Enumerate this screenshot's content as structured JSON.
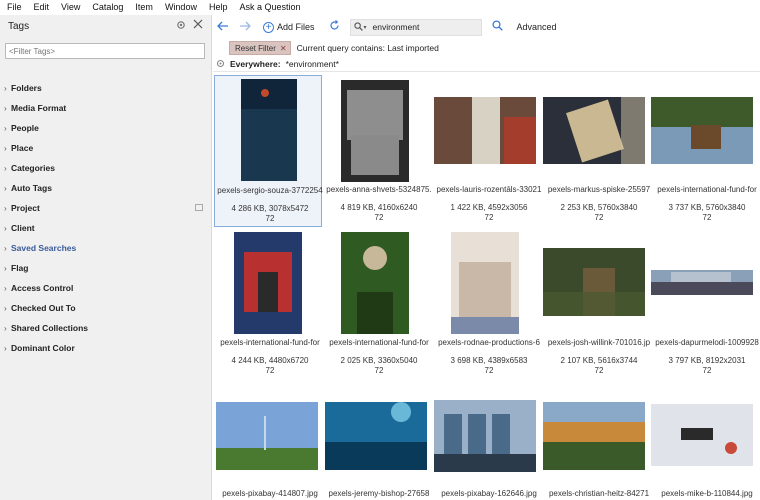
{
  "menu": [
    "File",
    "Edit",
    "View",
    "Catalog",
    "Item",
    "Window",
    "Help",
    "Ask a Question"
  ],
  "sidebar": {
    "title": "Tags",
    "filter_placeholder": "<Filter Tags>",
    "items": [
      {
        "label": "Folders"
      },
      {
        "label": "Media Format"
      },
      {
        "label": "People"
      },
      {
        "label": "Place"
      },
      {
        "label": "Categories"
      },
      {
        "label": "Auto Tags"
      },
      {
        "label": "Project"
      },
      {
        "label": "Client"
      },
      {
        "label": "Saved Searches"
      },
      {
        "label": "Flag"
      },
      {
        "label": "Access Control"
      },
      {
        "label": "Checked Out To"
      },
      {
        "label": "Shared Collections"
      },
      {
        "label": "Dominant Color"
      }
    ]
  },
  "toolbar": {
    "add_files": "Add Files",
    "search_value": "environment",
    "advanced": "Advanced"
  },
  "filter": {
    "reset_label": "Reset Filter",
    "query_text": "Current query contains: Last imported",
    "scope_label": "Everywhere:",
    "scope_value": "*environment*"
  },
  "assets": [
    {
      "name": "pexels-sergio-souza-3772254",
      "size": "4 286 KB, 3078x5472",
      "dpi": "72",
      "colors": [
        "#10253a",
        "#1f3f5a",
        "#c24a2a"
      ]
    },
    {
      "name": "pexels-anna-shvets-5324875.",
      "size": "4 819 KB, 4160x6240",
      "dpi": "72",
      "colors": [
        "#2a2a2a",
        "#8a8a8a",
        "#e0e0e0"
      ]
    },
    {
      "name": "pexels-lauris-rozentāls-33021",
      "size": "1 422 KB, 4592x3056",
      "dpi": "72",
      "colors": [
        "#6a4a3a",
        "#d8d2c4",
        "#b43a2a"
      ]
    },
    {
      "name": "pexels-markus-spiske-25597",
      "size": "2 253 KB, 5760x3840",
      "dpi": "72",
      "colors": [
        "#2a2f3a",
        "#c9b892",
        "#d2c6a4"
      ]
    },
    {
      "name": "pexels-international-fund-for",
      "size": "3 737 KB, 5760x3840",
      "dpi": "72",
      "colors": [
        "#3f5a2a",
        "#7a9ab8",
        "#6a4a2a"
      ]
    },
    {
      "name": "pexels-international-fund-for",
      "size": "4 244 KB, 4480x6720",
      "dpi": "72",
      "colors": [
        "#b83030",
        "#233a6a",
        "#2a2a2a"
      ]
    },
    {
      "name": "pexels-international-fund-for",
      "size": "2 025 KB, 3360x5040",
      "dpi": "72",
      "colors": [
        "#2f5a22",
        "#c8b89a",
        "#1f3a15"
      ]
    },
    {
      "name": "pexels-rodnae-productions-6",
      "size": "3 698 KB, 4389x6583",
      "dpi": "72",
      "colors": [
        "#c9b8a8",
        "#e8e0d6",
        "#7a8aa8"
      ]
    },
    {
      "name": "pexels-josh-willink-701016.jp",
      "size": "2 107 KB, 5616x3744",
      "dpi": "72",
      "colors": [
        "#3a4a2a",
        "#6a5a3a",
        "#4a5a30"
      ]
    },
    {
      "name": "pexels-dapurmelodi-1009928",
      "size": "3 797 KB, 8192x2031",
      "dpi": "72",
      "colors": [
        "#8aa0b8",
        "#4a4a5a",
        "#c8ced8"
      ]
    },
    {
      "name": "pexels-pixabay-414807.jpg",
      "colors": [
        "#7aa4d8",
        "#4a7a30",
        "#c8d8ea"
      ]
    },
    {
      "name": "pexels-jeremy-bishop-27658",
      "colors": [
        "#1a6a9a",
        "#0a3a5a",
        "#6ab8d8"
      ]
    },
    {
      "name": "pexels-pixabay-162646.jpg",
      "colors": [
        "#4a6a8a",
        "#2a3a4a",
        "#9ab0c8"
      ]
    },
    {
      "name": "pexels-christian-heitz-84271",
      "colors": [
        "#c88a3a",
        "#3a5a2a",
        "#8aa8c8"
      ]
    },
    {
      "name": "pexels-mike-b-110844.jpg",
      "colors": [
        "#e0e4ea",
        "#2a2a2a",
        "#c84a3a"
      ]
    }
  ]
}
